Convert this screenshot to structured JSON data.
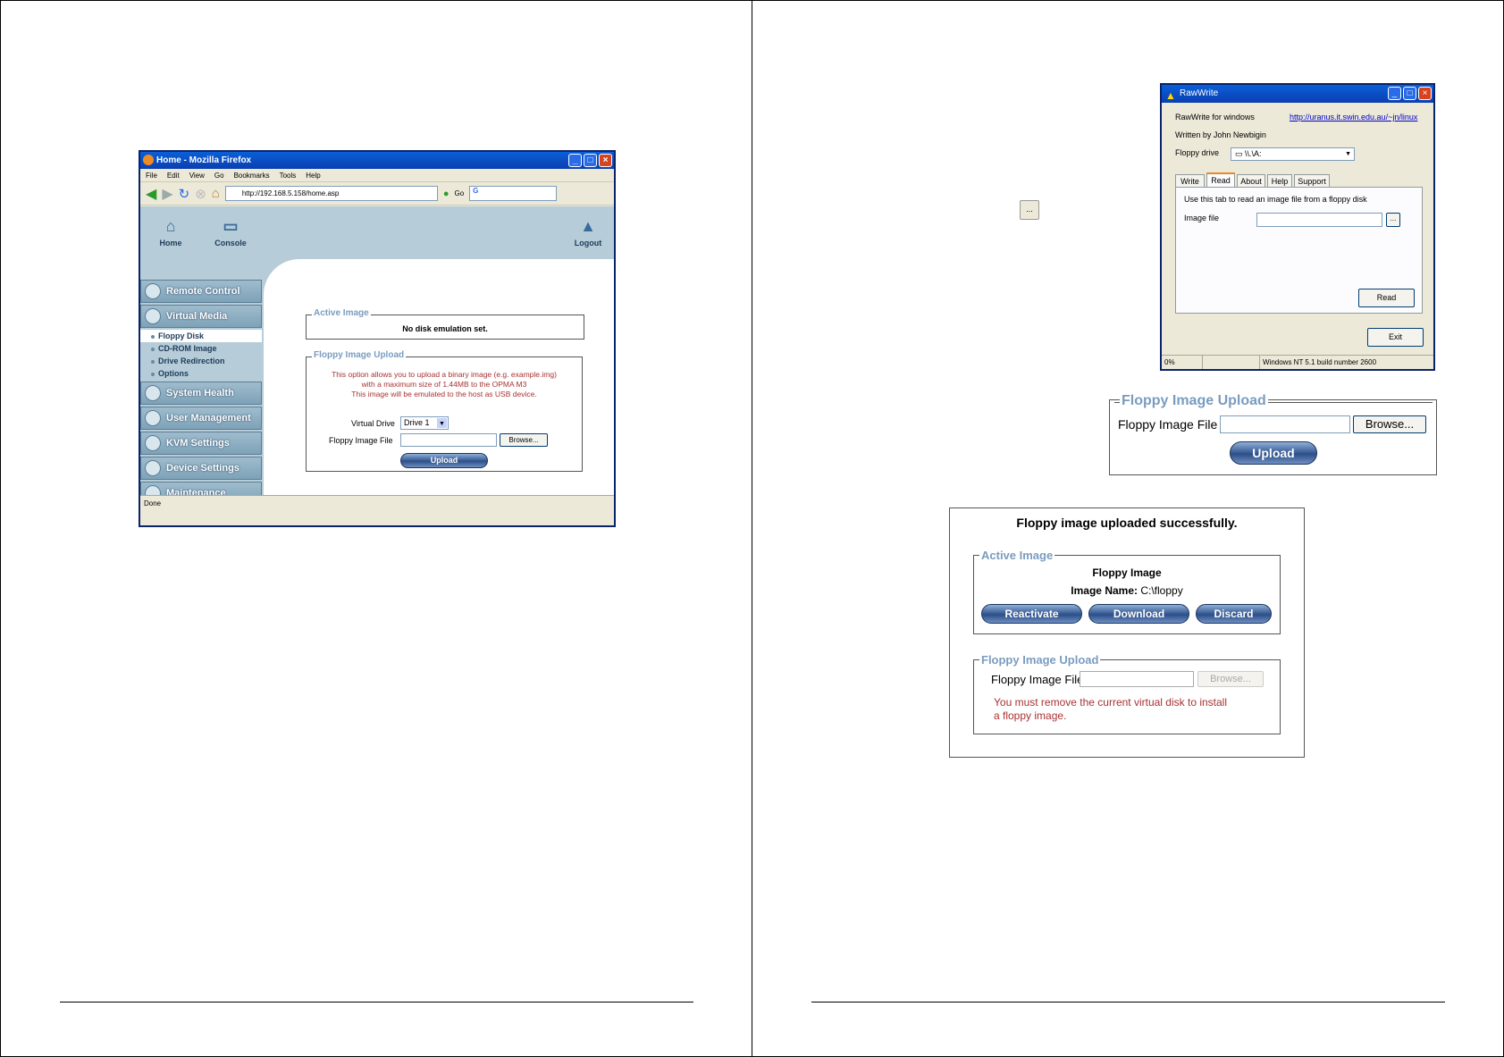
{
  "firefox": {
    "window_title": "Home - Mozilla Firefox",
    "menu": [
      "File",
      "Edit",
      "View",
      "Go",
      "Bookmarks",
      "Tools",
      "Help"
    ],
    "url": "http://192.168.5.158/home.asp",
    "go_label": "Go",
    "search_prefix": "G",
    "status": "Done",
    "header": {
      "home": "Home",
      "console": "Console",
      "logout": "Logout"
    },
    "sidebar": {
      "remote_control": "Remote Control",
      "virtual_media": "Virtual Media",
      "sub": [
        "Floppy Disk",
        "CD-ROM Image",
        "Drive Redirection",
        "Options"
      ],
      "system_health": "System Health",
      "user_management": "User Management",
      "kvm_settings": "KVM Settings",
      "device_settings": "Device Settings",
      "maintenance": "Maintenance"
    },
    "active_image": {
      "legend": "Active Image",
      "text": "No disk emulation set."
    },
    "upload": {
      "legend": "Floppy Image Upload",
      "info": [
        "This option allows you to upload a binary image (e.g. example.img)",
        "with a maximum size of 1.44MB to the OPMA M3",
        "This image will be emulated to the host as USB device."
      ],
      "virtual_drive_label": "Virtual Drive",
      "virtual_drive_value": "Drive 1",
      "file_label": "Floppy Image File",
      "browse": "Browse...",
      "upload": "Upload"
    }
  },
  "small_button": "...",
  "rawwrite": {
    "title": "RawWrite",
    "line1": "RawWrite for windows",
    "link": "http://uranus.it.swin.edu.au/~jn/linux",
    "line2": "Written by John Newbigin",
    "floppy_label": "Floppy drive",
    "floppy_value": "\\\\.\\A:",
    "tabs": [
      "Write",
      "Read",
      "About",
      "Help",
      "Support"
    ],
    "panel_text": "Use this tab to read an image file from a floppy disk",
    "image_file_label": "Image file",
    "browse_small": "...",
    "read_button": "Read",
    "exit_button": "Exit",
    "status_pct": "0%",
    "status_os": "Windows NT 5.1 build number 2600"
  },
  "upload_panel": {
    "legend": "Floppy Image Upload",
    "file_label": "Floppy Image File",
    "browse": "Browse...",
    "upload": "Upload"
  },
  "success_panel": {
    "heading": "Floppy image uploaded successfully.",
    "active_legend": "Active Image",
    "image_title": "Floppy Image",
    "image_name_label": "Image Name:",
    "image_name_value": "C:\\floppy",
    "reactivate": "Reactivate",
    "download": "Download",
    "discard": "Discard",
    "upload_legend": "Floppy Image Upload",
    "file_label": "Floppy Image File",
    "browse": "Browse...",
    "warning": [
      "You must remove the current virtual disk to install",
      "a floppy image."
    ]
  }
}
